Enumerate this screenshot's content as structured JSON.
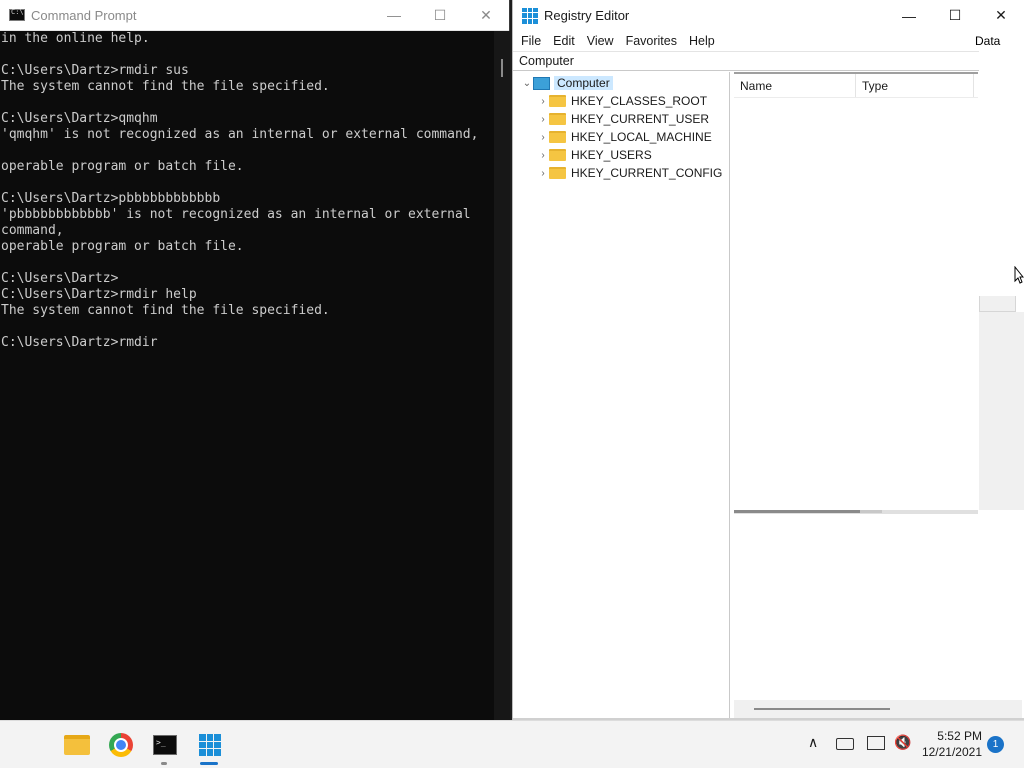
{
  "cmd": {
    "title": "Command Prompt",
    "lines": [
      "in the online help.",
      "",
      "C:\\Users\\Dartz>rmdir sus",
      "The system cannot find the file specified.",
      "",
      "C:\\Users\\Dartz>qmqhm",
      "'qmqhm' is not recognized as an internal or external command,",
      "",
      "operable program or batch file.",
      "",
      "C:\\Users\\Dartz>pbbbbbbbbbbbb",
      "'pbbbbbbbbbbbb' is not recognized as an internal or external",
      "command,",
      "operable program or batch file.",
      "",
      "C:\\Users\\Dartz>",
      "C:\\Users\\Dartz>rmdir help",
      "The system cannot find the file specified.",
      "",
      "C:\\Users\\Dartz>rmdir"
    ],
    "minimize": "—",
    "maximize": "☐",
    "close": "✕"
  },
  "regedit": {
    "title": "Registry Editor",
    "minimize": "—",
    "maximize": "☐",
    "close": "✕",
    "menu": [
      "File",
      "Edit",
      "View",
      "Favorites",
      "Help"
    ],
    "data_col_cut": "Data",
    "address": "Computer",
    "tree": {
      "root": "Computer",
      "root_expander": "⌄",
      "child_expander": "›",
      "children": [
        "HKEY_CLASSES_ROOT",
        "HKEY_CURRENT_USER",
        "HKEY_LOCAL_MACHINE",
        "HKEY_USERS",
        "HKEY_CURRENT_CONFIG"
      ]
    },
    "columns": {
      "name": "Name",
      "type": "Type"
    }
  },
  "taskbar": {
    "apps": [
      "start-icon",
      "file-explorer-icon",
      "chrome-icon",
      "command-prompt-icon",
      "registry-editor-icon"
    ],
    "tray_chevron": "∧",
    "volume_glyph": "🔇",
    "time": "5:52 PM",
    "date": "12/21/2021",
    "notification_count": "1"
  }
}
